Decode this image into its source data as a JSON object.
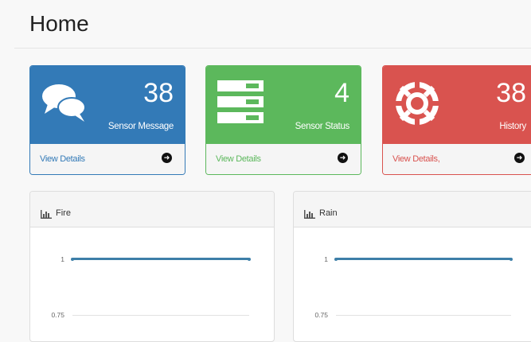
{
  "page": {
    "title": "Home"
  },
  "cards": [
    {
      "count": "38",
      "label": "Sensor Message",
      "link": "View Details",
      "icon": "comments-icon",
      "color": "#337ab7"
    },
    {
      "count": "4",
      "label": "Sensor Status",
      "link": "View Details",
      "icon": "server-icon",
      "color": "#5cb85c"
    },
    {
      "count": "38",
      "label": "History",
      "link": "View Details,",
      "icon": "life-ring-icon",
      "color": "#d9534f"
    }
  ],
  "panels": [
    {
      "title": "Fire",
      "icon": "bar-chart-icon",
      "ticks": [
        "1",
        "0.75"
      ]
    },
    {
      "title": "Rain",
      "icon": "bar-chart-icon",
      "ticks": [
        "1",
        "0.75"
      ]
    }
  ],
  "chart_data": [
    {
      "type": "line",
      "title": "Fire",
      "y_ticks": [
        "1",
        "0.75"
      ],
      "series": [
        {
          "values": [
            1,
            1,
            1,
            1,
            1,
            1,
            1,
            1
          ]
        }
      ]
    },
    {
      "type": "line",
      "title": "Rain",
      "y_ticks": [
        "1",
        "0.75"
      ],
      "series": [
        {
          "values": [
            1,
            1,
            1,
            1,
            1,
            1,
            1,
            1
          ]
        }
      ]
    }
  ],
  "arrow_glyph": "➜"
}
